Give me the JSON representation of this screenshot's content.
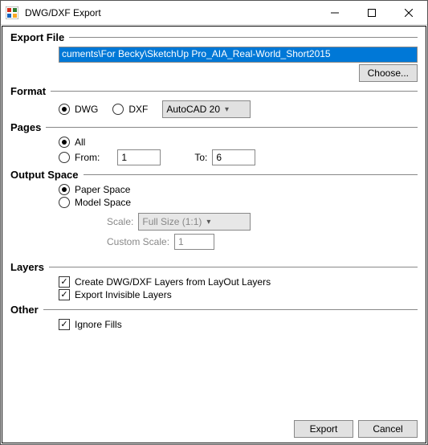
{
  "window": {
    "title": "DWG/DXF Export"
  },
  "exportFile": {
    "label": "Export File",
    "path": "cuments\\For Becky\\SketchUp Pro_AIA_Real-World_Short2015",
    "chooseLabel": "Choose..."
  },
  "format": {
    "label": "Format",
    "optDwg": "DWG",
    "optDxf": "DXF",
    "selected": "dwg",
    "version": "AutoCAD 20"
  },
  "pages": {
    "label": "Pages",
    "optAll": "All",
    "optFromLabel": "From:",
    "toLabel": "To:",
    "selected": "all",
    "from": "1",
    "to": "6"
  },
  "outputSpace": {
    "label": "Output Space",
    "optPaper": "Paper Space",
    "optModel": "Model Space",
    "selected": "paper",
    "scaleLabel": "Scale:",
    "scaleValue": "Full Size (1:1)",
    "customScaleLabel": "Custom Scale:",
    "customScaleValue": "1"
  },
  "layers": {
    "label": "Layers",
    "optCreate": "Create DWG/DXF Layers from LayOut Layers",
    "createChecked": true,
    "optExportInvisible": "Export Invisible Layers",
    "exportInvisibleChecked": true
  },
  "other": {
    "label": "Other",
    "optIgnoreFills": "Ignore Fills",
    "ignoreFillsChecked": true
  },
  "footer": {
    "export": "Export",
    "cancel": "Cancel"
  }
}
